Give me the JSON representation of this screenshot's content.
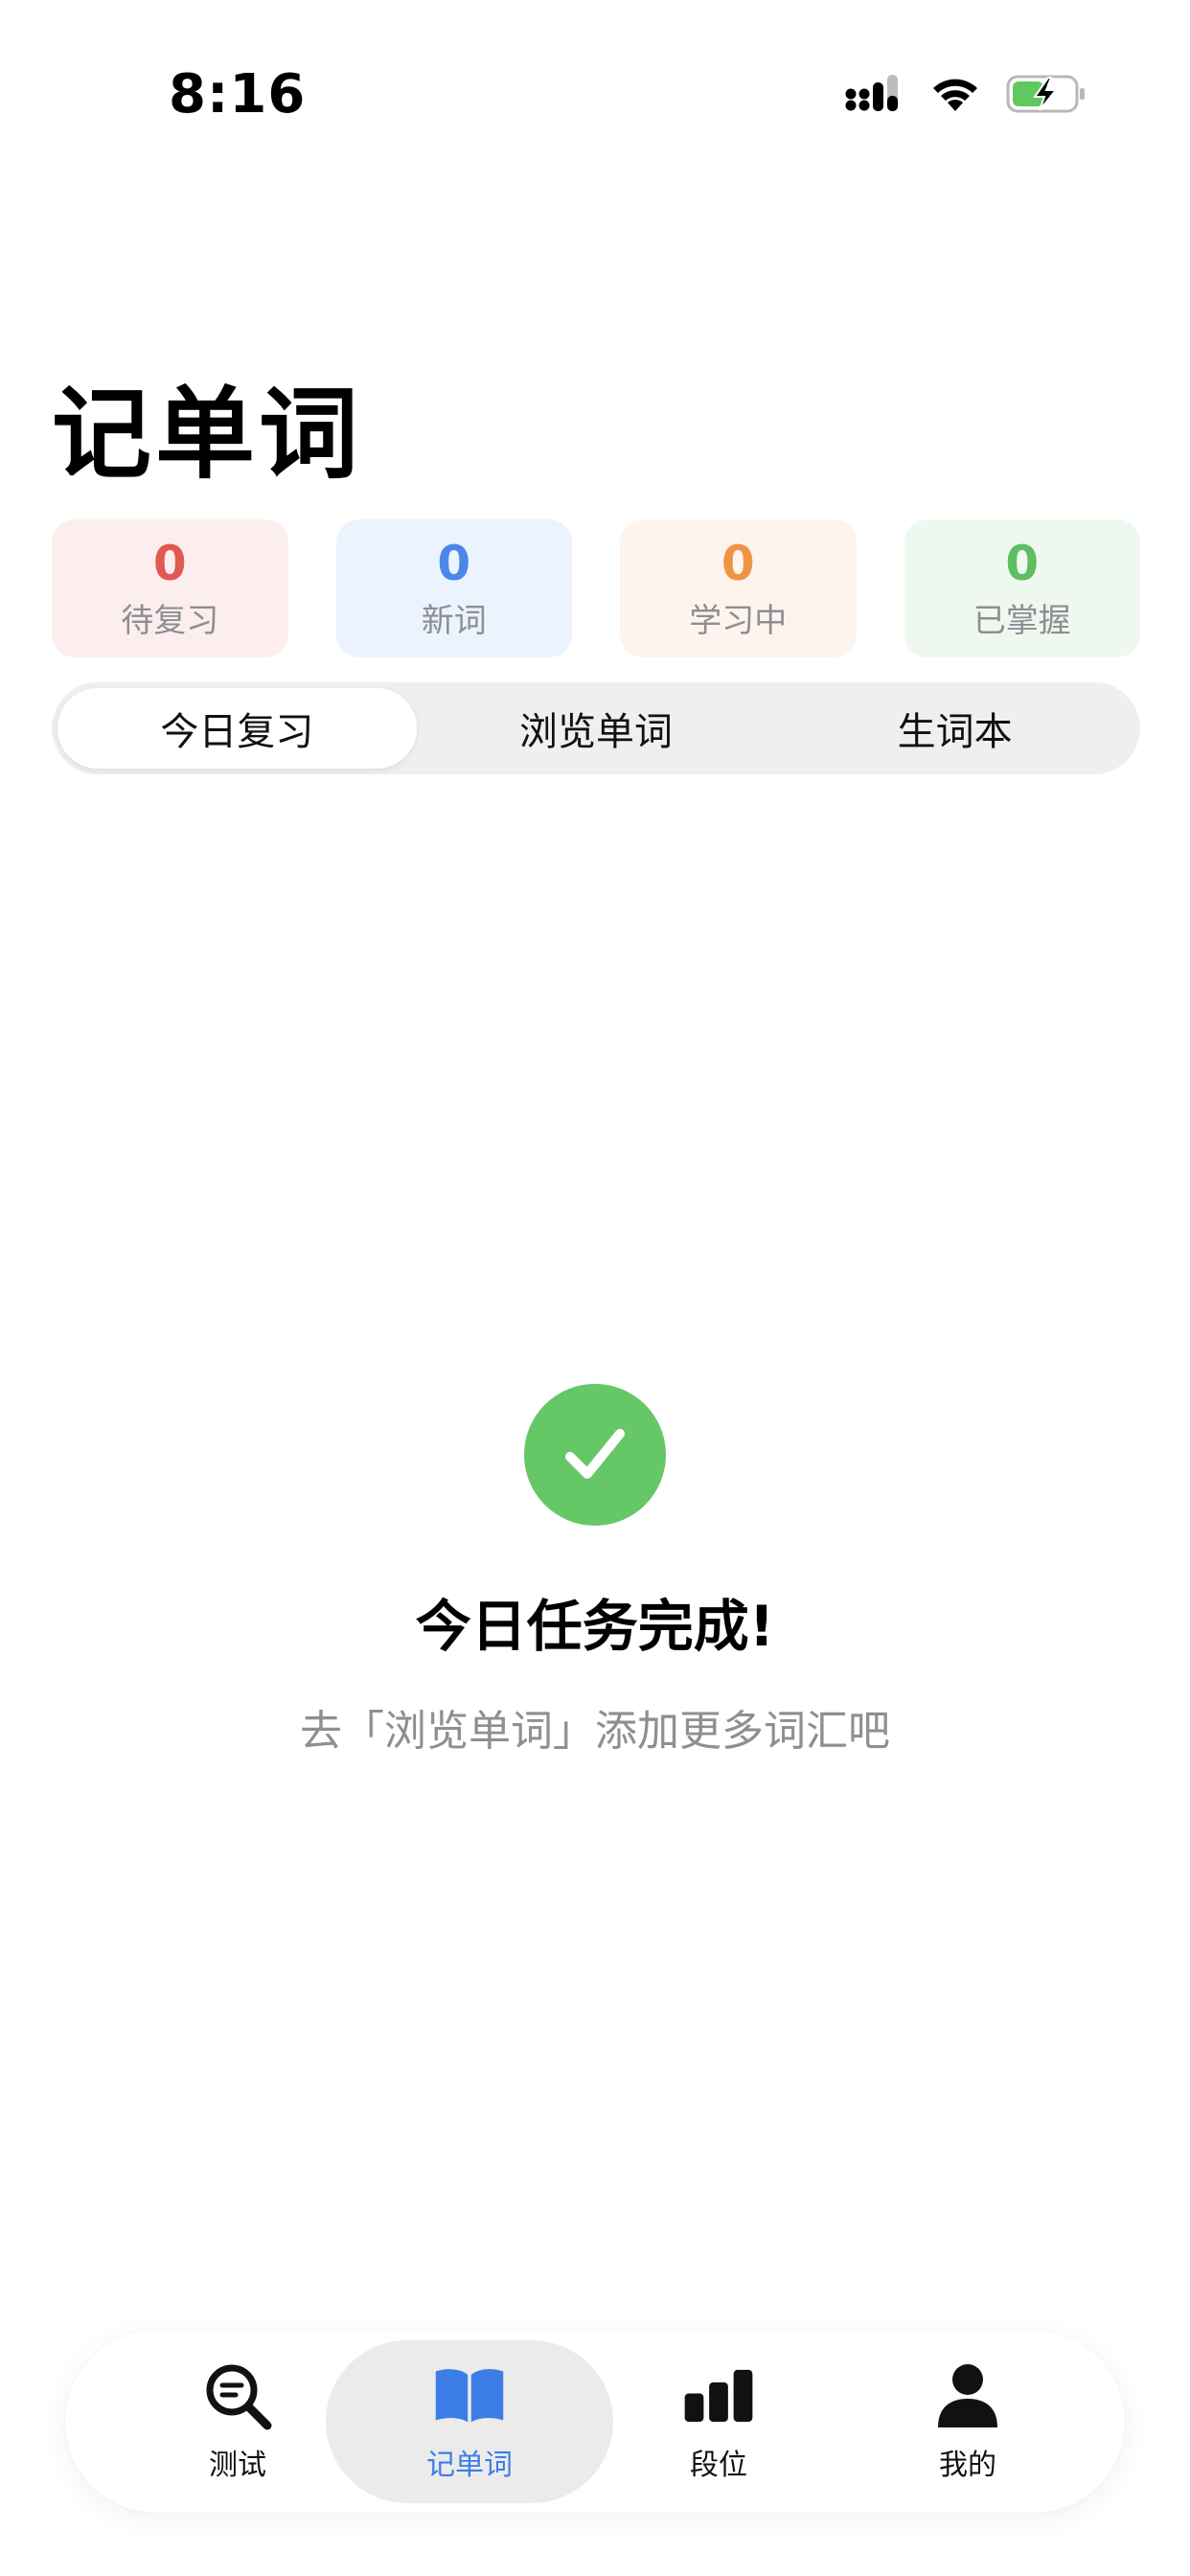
{
  "status_bar": {
    "time": "8:16"
  },
  "page": {
    "title": "记单词"
  },
  "stats": [
    {
      "value": "0",
      "label": "待复习",
      "color": "#e05a52",
      "bg": "#fdeeee"
    },
    {
      "value": "0",
      "label": "新词",
      "color": "#4b87e6",
      "bg": "#eaf3fe"
    },
    {
      "value": "0",
      "label": "学习中",
      "color": "#ef9444",
      "bg": "#fef4ee"
    },
    {
      "value": "0",
      "label": "已掌握",
      "color": "#5fbd62",
      "bg": "#eef8ef"
    }
  ],
  "segments": [
    {
      "label": "今日复习",
      "active": true
    },
    {
      "label": "浏览单词",
      "active": false
    },
    {
      "label": "生词本",
      "active": false
    }
  ],
  "empty_state": {
    "title": "今日任务完成!",
    "subtitle": "去「浏览单词」添加更多词汇吧"
  },
  "tabs": [
    {
      "label": "测试",
      "icon": "search-icon",
      "active": false
    },
    {
      "label": "记单词",
      "icon": "book-icon",
      "active": true
    },
    {
      "label": "段位",
      "icon": "bar-chart-icon",
      "active": false
    },
    {
      "label": "我的",
      "icon": "person-icon",
      "active": false
    }
  ],
  "colors": {
    "accent": "#3d7de8",
    "success": "#66c766",
    "battery_green": "#5fc95f"
  }
}
